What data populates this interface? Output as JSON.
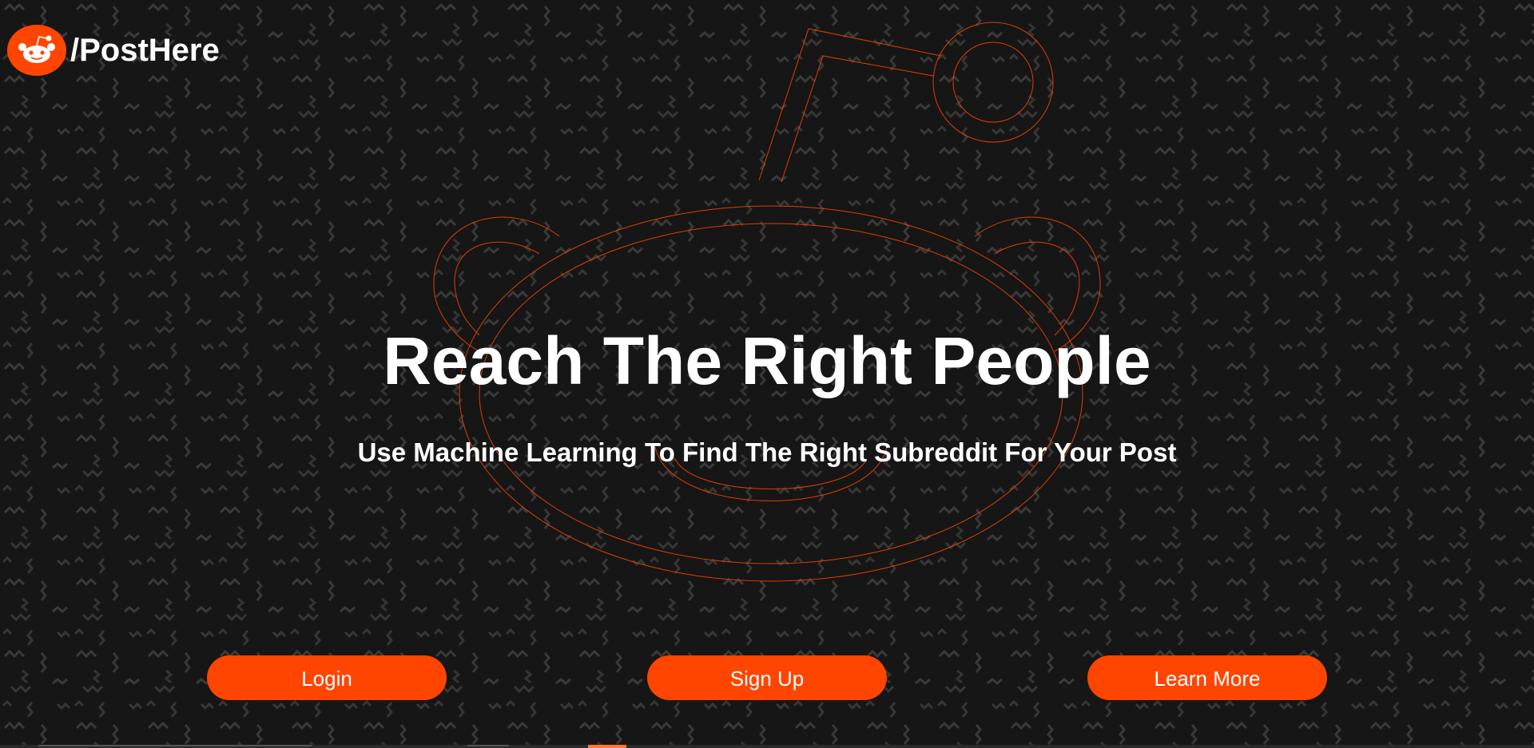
{
  "brand": {
    "name": "/PostHere",
    "logo_icon": "reddit-alien-icon",
    "accent_color": "#ff4500"
  },
  "hero": {
    "title": "Reach The Right People",
    "subtitle": "Use Machine Learning To Find The Right Subreddit For Your Post"
  },
  "actions": {
    "login_label": "Login",
    "signup_label": "Sign Up",
    "learn_more_label": "Learn More"
  },
  "background": {
    "pattern": "zigzag-squiggle",
    "base_color": "#161616",
    "pattern_color": "#3a3a3a",
    "mascot_outline": "reddit-alien-outline",
    "mascot_color": "#ff4500"
  }
}
